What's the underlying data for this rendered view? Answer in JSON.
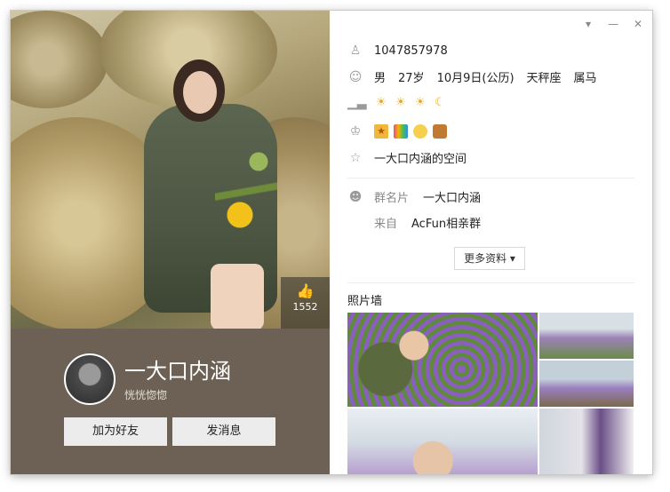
{
  "profile": {
    "nickname": "一大口内涵",
    "signature": "恍恍惚惚",
    "likes": "1552",
    "qq_number": "1047857978",
    "gender": "男",
    "age": "27岁",
    "birthday": "10月9日(公历)",
    "constellation": "天秤座",
    "zodiac": "属马",
    "space_link": "一大口内涵的空间",
    "group_card_label": "群名片",
    "group_card_value": "一大口内涵",
    "from_label": "来自",
    "from_value": "AcFun相亲群"
  },
  "buttons": {
    "add_friend": "加为好友",
    "send_message": "发消息",
    "more_info": "更多资料 ▾"
  },
  "album": {
    "title": "照片墙"
  },
  "icons": {
    "level": [
      "sun-icon",
      "sun-icon",
      "sun-icon",
      "moon-icon"
    ],
    "vip": [
      "star-vip-icon",
      "app-icon",
      "duck-icon",
      "bear-icon"
    ]
  },
  "colors": {
    "panel_bg": "#6c6154",
    "accent_sun": "#e9a81b"
  }
}
